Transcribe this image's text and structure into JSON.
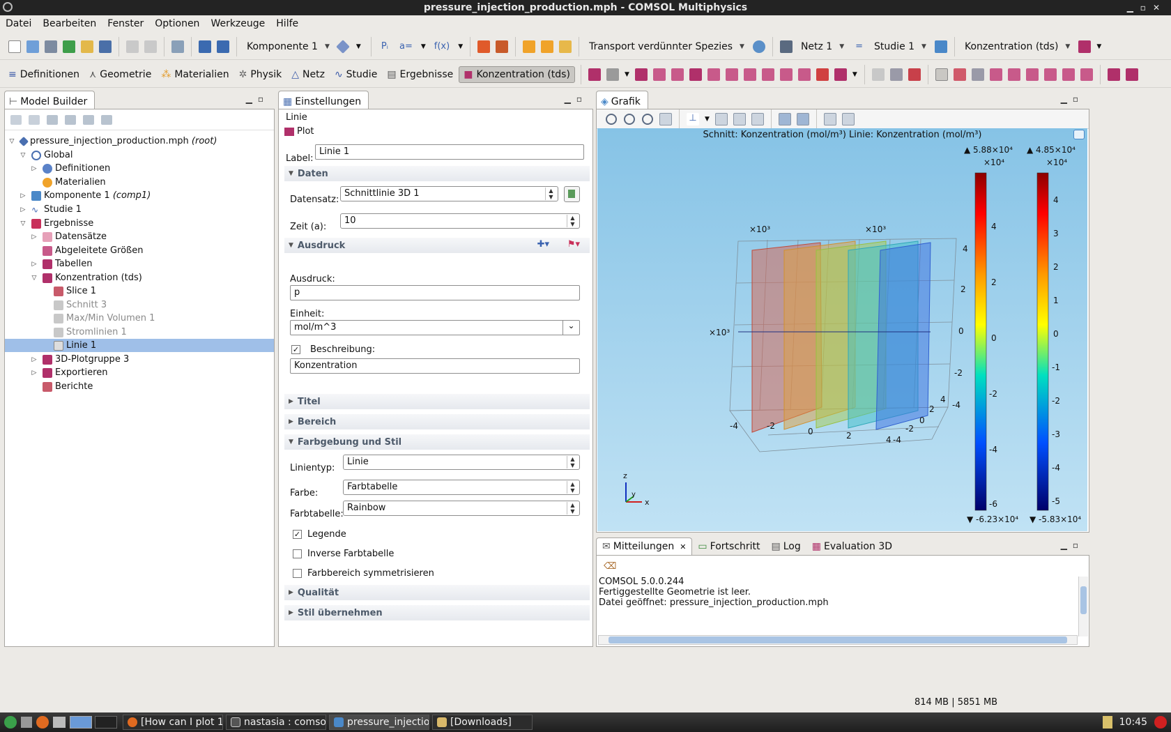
{
  "window": {
    "title": "pressure_injection_production.mph - COMSOL Multiphysics"
  },
  "menu": [
    "Datei",
    "Bearbeiten",
    "Fenster",
    "Optionen",
    "Werkzeuge",
    "Hilfe"
  ],
  "toolbar1": {
    "komponente": "Komponente 1",
    "physics": "Transport verdünnter Spezies",
    "mesh": "Netz 1",
    "study": "Studie 1",
    "plot": "Konzentration (tds)"
  },
  "ribbon_tabs": [
    {
      "label": "Definitionen",
      "glyph": "≡"
    },
    {
      "label": "Geometrie",
      "glyph": "⋏"
    },
    {
      "label": "Materialien",
      "glyph": "⁂"
    },
    {
      "label": "Physik",
      "glyph": "✲"
    },
    {
      "label": "Netz",
      "glyph": "△"
    },
    {
      "label": "Studie",
      "glyph": "∿"
    },
    {
      "label": "Ergebnisse",
      "glyph": "▤"
    },
    {
      "label": "Konzentration (tds)",
      "glyph": "■"
    }
  ],
  "model_builder": {
    "title": "Model Builder",
    "root_name": "pressure_injection_production.mph",
    "root_suffix": "(root)",
    "global": "Global",
    "definitionen": "Definitionen",
    "materialien": "Materialien",
    "komponente": "Komponente 1",
    "komponente_suffix": "(comp1)",
    "studie": "Studie 1",
    "ergebnisse": "Ergebnisse",
    "datensaetze": "Datensätze",
    "abgeleitete": "Abgeleitete Größen",
    "tabellen": "Tabellen",
    "konzentration": "Konzentration (tds)",
    "slice": "Slice 1",
    "schnitt": "Schnitt 3",
    "maxmin": "Max/Min Volumen 1",
    "stromlinien": "Stromlinien 1",
    "linie": "Linie 1",
    "plotgruppe": "3D-Plotgruppe 3",
    "exportieren": "Exportieren",
    "berichte": "Berichte"
  },
  "settings": {
    "title": "Einstellungen",
    "subtitle": "Linie",
    "plot_button": "Plot",
    "label_caption": "Label:",
    "label_value": "Linie 1",
    "section_daten": "Daten",
    "datensatz_caption": "Datensatz:",
    "datensatz_value": "Schnittlinie 3D 1",
    "zeit_caption": "Zeit (a):",
    "zeit_value": "10",
    "section_ausdruck": "Ausdruck",
    "ausdruck_caption": "Ausdruck:",
    "ausdruck_value": "p",
    "einheit_caption": "Einheit:",
    "einheit_value": "mol/m^3",
    "beschreibung_caption": "Beschreibung:",
    "beschreibung_value": "Konzentration",
    "section_titel": "Titel",
    "section_bereich": "Bereich",
    "section_farbgebung": "Farbgebung und Stil",
    "linientyp_caption": "Linientyp:",
    "linientyp_value": "Linie",
    "farbe_caption": "Farbe:",
    "farbe_value": "Farbtabelle",
    "farbtabelle_caption": "Farbtabelle:",
    "farbtabelle_value": "Rainbow",
    "legende": "Legende",
    "inverse": "Inverse Farbtabelle",
    "symmetrisieren": "Farbbereich symmetrisieren",
    "section_qualitaet": "Qualität",
    "section_stil": "Stil übernehmen"
  },
  "graphics": {
    "title": "Grafik",
    "plot_title": "Schnitt: Konzentration (mol/m³)  Linie: Konzentration (mol/m³)",
    "legend1": {
      "max": "▲ 5.88×10⁴",
      "exp": "×10⁴",
      "min": "▼ -6.23×10⁴",
      "ticks": [
        "4",
        "2",
        "0",
        "-2",
        "-4",
        "-6"
      ]
    },
    "legend2": {
      "max": "▲ 4.85×10⁴",
      "exp": "×10⁴",
      "min": "▼ -5.83×10⁴",
      "ticks": [
        "4",
        "3",
        "2",
        "1",
        "0",
        "-1",
        "-2",
        "-3",
        "-4",
        "-5"
      ]
    },
    "axis_exp": [
      "×10³",
      "×10³",
      "×10³"
    ],
    "z_ticks": [
      "4",
      "2",
      "0",
      "-2",
      "-4"
    ],
    "x_ticks": [
      "-4",
      "-2",
      "0",
      "2",
      "4"
    ],
    "y_ticks": [
      "-4",
      "-2",
      "0",
      "2",
      "4"
    ],
    "triad": {
      "z": "z",
      "y": "y",
      "x": "x"
    }
  },
  "messages": {
    "tabs": [
      "Mitteilungen",
      "Fortschritt",
      "Log",
      "Evaluation 3D"
    ],
    "lines": [
      "COMSOL 5.0.0.244",
      "Fertiggestellte Geometrie ist leer.",
      "Datei geöffnet: pressure_injection_production.mph"
    ]
  },
  "status": {
    "memory": "814 MB | 5851 MB"
  },
  "taskbar": {
    "items": [
      "[How can I plot 1...",
      "nastasia : comso...",
      "pressure_injectio...",
      "[Downloads]"
    ],
    "clock": "10:45"
  }
}
